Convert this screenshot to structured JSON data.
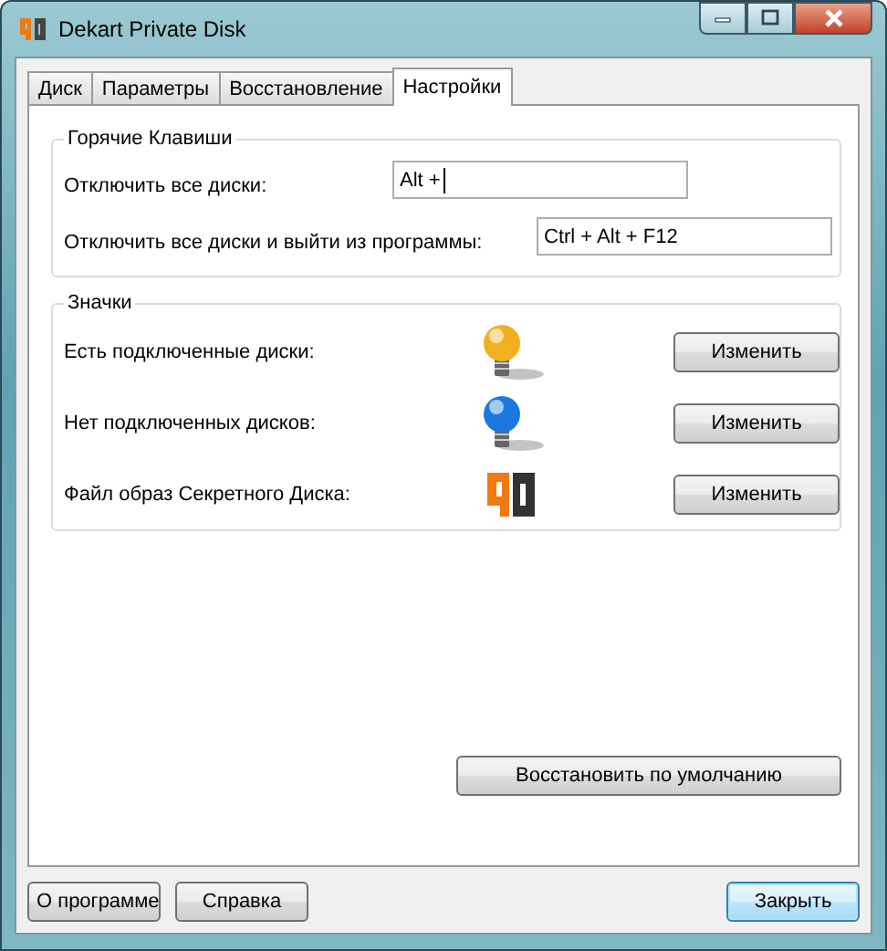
{
  "window": {
    "title": "Dekart Private Disk"
  },
  "tabs": [
    {
      "label": "Диск",
      "selected": false
    },
    {
      "label": "Параметры",
      "selected": false
    },
    {
      "label": "Восстановление",
      "selected": false
    },
    {
      "label": "Настройки",
      "selected": true
    }
  ],
  "hotkeys": {
    "title": "Горячие Клавиши",
    "rows": [
      {
        "label": "Отключить все диски:",
        "value": "Alt +",
        "focused": true
      },
      {
        "label": "Отключить все диски и выйти из программы:",
        "value": "Ctrl + Alt + F12",
        "focused": false
      }
    ]
  },
  "icons": {
    "title": "Значки",
    "rows": [
      {
        "label": "Есть подключенные диски:",
        "kind": "bulb",
        "color": "#f0b020",
        "button": "Изменить"
      },
      {
        "label": "Нет подключенных дисков:",
        "kind": "bulb",
        "color": "#1c78e0",
        "button": "Изменить"
      },
      {
        "label": "Файл образ Секретного Диска:",
        "kind": "logo",
        "button": "Изменить"
      }
    ]
  },
  "restore_button": "Восстановить по умолчанию",
  "footer": {
    "left_buttons": [
      "О программе",
      "Справка"
    ],
    "close_button": "Закрыть"
  }
}
